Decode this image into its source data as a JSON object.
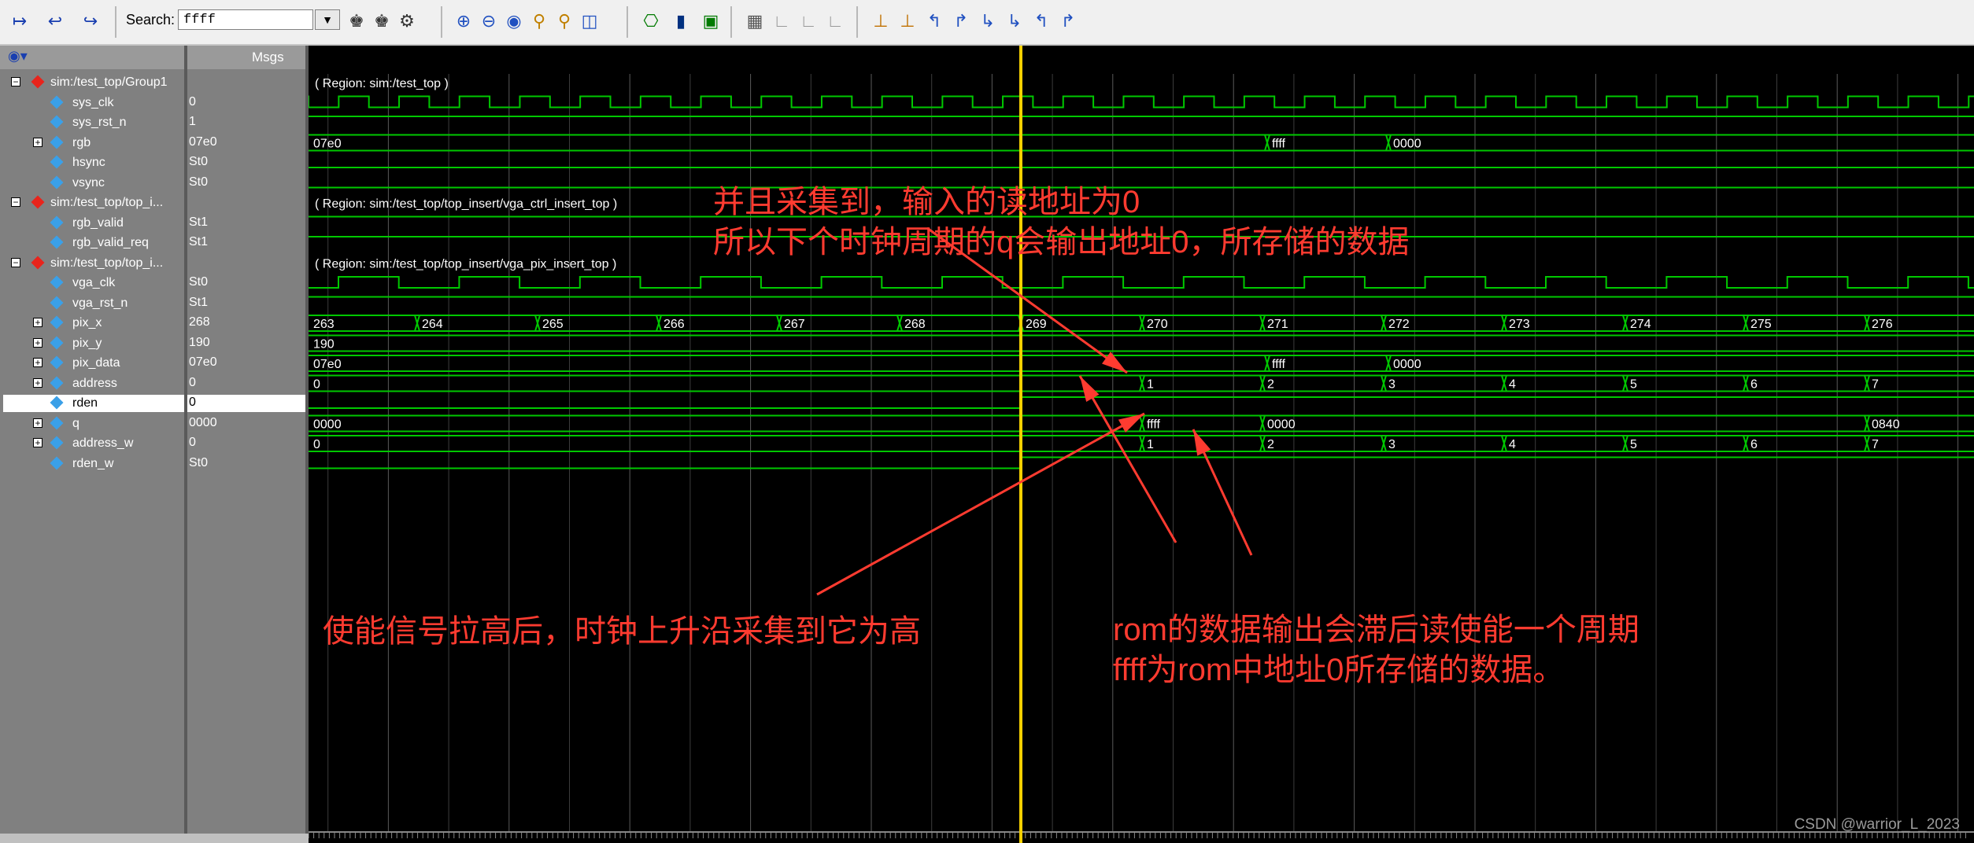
{
  "toolbar": {
    "search_label": "Search:",
    "search_value": "ffff"
  },
  "panel": {
    "msgs_header": "Msgs"
  },
  "signals": [
    {
      "name": "sim:/test_top/Group1",
      "value": "",
      "kind": "group"
    },
    {
      "name": "sys_clk",
      "value": "0",
      "kind": "wire"
    },
    {
      "name": "sys_rst_n",
      "value": "1",
      "kind": "wire"
    },
    {
      "name": "rgb",
      "value": "07e0",
      "kind": "bus"
    },
    {
      "name": "hsync",
      "value": "St0",
      "kind": "wire"
    },
    {
      "name": "vsync",
      "value": "St0",
      "kind": "wire"
    },
    {
      "name": "sim:/test_top/top_i...",
      "value": "",
      "kind": "group"
    },
    {
      "name": "rgb_valid",
      "value": "St1",
      "kind": "wire"
    },
    {
      "name": "rgb_valid_req",
      "value": "St1",
      "kind": "wire"
    },
    {
      "name": "sim:/test_top/top_i...",
      "value": "",
      "kind": "group"
    },
    {
      "name": "vga_clk",
      "value": "St0",
      "kind": "wire"
    },
    {
      "name": "vga_rst_n",
      "value": "St1",
      "kind": "wire"
    },
    {
      "name": "pix_x",
      "value": "268",
      "kind": "bus"
    },
    {
      "name": "pix_y",
      "value": "190",
      "kind": "bus"
    },
    {
      "name": "pix_data",
      "value": "07e0",
      "kind": "bus"
    },
    {
      "name": "address",
      "value": "0",
      "kind": "bus"
    },
    {
      "name": "rden",
      "value": "0",
      "kind": "wire"
    },
    {
      "name": "q",
      "value": "0000",
      "kind": "bus"
    },
    {
      "name": "address_w",
      "value": "0",
      "kind": "bus"
    },
    {
      "name": "rden_w",
      "value": "St0",
      "kind": "wire"
    }
  ],
  "regions": {
    "group1": "( Region: sim:/test_top )",
    "ctrl": "( Region: sim:/test_top/top_insert/vga_ctrl_insert_top )",
    "pix": "( Region: sim:/test_top/top_insert/vga_pix_insert_top )"
  },
  "bus_values": {
    "rgb": [
      "07e0",
      "ffff",
      "0000"
    ],
    "pix_x": [
      "263",
      "264",
      "265",
      "266",
      "267",
      "268",
      "269",
      "270",
      "271",
      "272",
      "273",
      "274",
      "275",
      "276"
    ],
    "pix_y": [
      "190"
    ],
    "pix_data": [
      "07e0",
      "ffff",
      "0000"
    ],
    "address": [
      "0",
      "1",
      "2",
      "3",
      "4",
      "5",
      "6",
      "7"
    ],
    "q": [
      "0000",
      "ffff",
      "0000",
      "0840"
    ],
    "address_w": [
      "0",
      "1",
      "2",
      "3",
      "4",
      "5",
      "6",
      "7"
    ]
  },
  "annotations": {
    "top": [
      "并且采集到，输入的读地址为0",
      "所以下个时钟周期的q会输出地址0，所存储的数据"
    ],
    "left": "使能信号拉高后，时钟上升沿采集到它为高",
    "right": [
      "rom的数据输出会滞后读使能一个周期",
      "ffff为rom中地址0所存储的数据。"
    ]
  },
  "watermark": "CSDN @warrior_L_2023",
  "colors": {
    "wave": "#00c800",
    "cursor": "#f5d000",
    "annotation": "#ff3b30",
    "grid": "#5a5a5a"
  }
}
